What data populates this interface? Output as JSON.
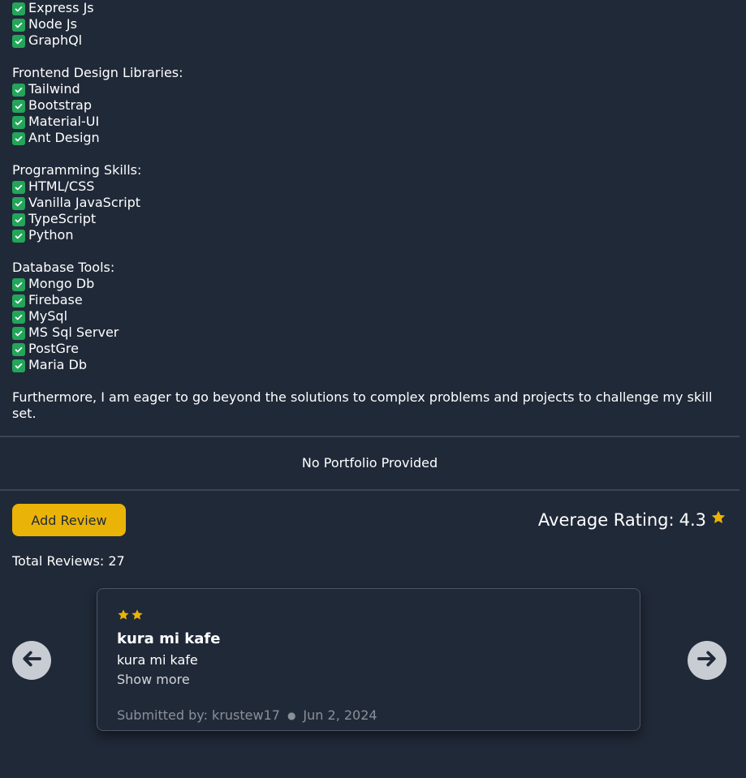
{
  "bio": {
    "lines_top": [
      {
        "type": "item",
        "text": "Express Js"
      },
      {
        "type": "item",
        "text": "Node Js"
      },
      {
        "type": "item",
        "text": "GraphQl"
      },
      {
        "type": "gap"
      },
      {
        "type": "heading",
        "text": "Frontend Design Libraries:"
      },
      {
        "type": "item",
        "text": "Tailwind"
      },
      {
        "type": "item",
        "text": "Bootstrap"
      },
      {
        "type": "item",
        "text": "Material-UI"
      },
      {
        "type": "item",
        "text": "Ant Design"
      },
      {
        "type": "gap"
      },
      {
        "type": "heading",
        "text": "Programming Skills:"
      },
      {
        "type": "item",
        "text": "HTML/CSS"
      },
      {
        "type": "item",
        "text": "Vanilla JavaScript"
      },
      {
        "type": "item",
        "text": "TypeScript"
      },
      {
        "type": "item",
        "text": "Python"
      },
      {
        "type": "gap"
      },
      {
        "type": "heading",
        "text": "Database Tools:"
      },
      {
        "type": "item",
        "text": "Mongo Db"
      },
      {
        "type": "item",
        "text": "Firebase"
      },
      {
        "type": "item",
        "text": "MySql"
      },
      {
        "type": "item",
        "text": "MS Sql Server"
      },
      {
        "type": "item",
        "text": "PostGre"
      },
      {
        "type": "item",
        "text": "Maria Db"
      },
      {
        "type": "gap"
      }
    ],
    "closing_paragraph": "Furthermore, I am eager to go beyond the solutions to complex problems and projects to challenge my skill set."
  },
  "portfolio": {
    "empty_text": "No Portfolio Provided"
  },
  "reviews": {
    "add_button_label": "Add Review",
    "average_label": "Average Rating:",
    "average_value": "4.3",
    "total_label": "Total Reviews: 27",
    "current": {
      "stars": 2,
      "title": "kura mi kafe",
      "body": "kura mi kafe",
      "show_more": "Show more",
      "submitted_by": "Submitted by: krustew17",
      "date": "Jun 2, 2024"
    }
  },
  "colors": {
    "background": "#202938",
    "accent": "#eab308",
    "check": "#23a55a"
  }
}
